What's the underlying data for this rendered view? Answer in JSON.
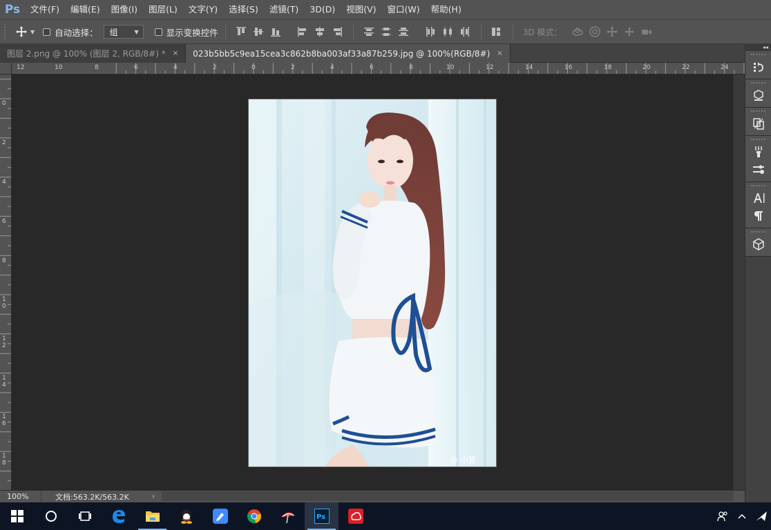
{
  "app": {
    "logo": "Ps"
  },
  "menu": [
    "文件(F)",
    "编辑(E)",
    "图像(I)",
    "图层(L)",
    "文字(Y)",
    "选择(S)",
    "滤镜(T)",
    "3D(D)",
    "视图(V)",
    "窗口(W)",
    "帮助(H)"
  ],
  "options": {
    "auto_select_label": "自动选择：",
    "auto_select_value": "组",
    "show_transform_label": "显示变换控件",
    "mode_3d_label": "3D 模式："
  },
  "tabs": [
    {
      "label": "图层 2.png @ 100% (图层 2, RGB/8#) *",
      "close": "×",
      "active": false
    },
    {
      "label": "023b5bb5c9ea15cea3c862b8ba003af33a87b259.jpg @ 100%(RGB/8#)",
      "close": "×",
      "active": true
    }
  ],
  "ruler": {
    "horizontal": [
      "12",
      "10",
      "8",
      "6",
      "4",
      "2",
      "0",
      "2",
      "4",
      "6",
      "8",
      "10",
      "12",
      "14",
      "16",
      "18",
      "20",
      "22",
      "24"
    ],
    "vertical": [
      "0",
      "2",
      "4",
      "6",
      "8",
      "10",
      "12",
      "14",
      "16",
      "18"
    ]
  },
  "photo": {
    "watermark": "@ 小慧"
  },
  "status": {
    "zoom": "100%",
    "doc_info": "文档:563.2K/563.2K",
    "arrow": "›"
  },
  "colors": {
    "ui_bg": "#535353",
    "canvas_bg": "#282828",
    "ps_blue": "#31a8ff",
    "taskbar": "#0d1524"
  },
  "taskbar": {
    "items": [
      "windows-start-icon",
      "cortana-icon",
      "task-view-icon",
      "edge-icon",
      "file-explorer-icon",
      "qq-icon",
      "feishu-icon",
      "chrome-icon",
      "umbrella-app-icon",
      "photoshop-icon",
      "creative-cloud-icon"
    ],
    "tray": [
      "people-icon",
      "chevron-up-icon",
      "network-icon"
    ]
  }
}
